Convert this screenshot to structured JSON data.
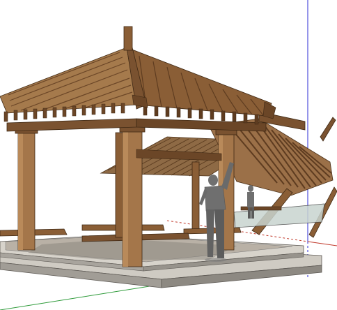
{
  "viewport": {
    "background": "#ffffff",
    "model": "3d-pavilion-model"
  },
  "axes": {
    "red_axis_color": "#c0392b",
    "green_axis_color": "#2e9b3a",
    "blue_axis_color": "#2b2bd6"
  },
  "materials": {
    "wood_light": "#a4764a",
    "wood_mid": "#8a5e36",
    "wood_dark": "#5e3c20",
    "wood_shadow": "#3e2814",
    "stone_top": "#c9c5bd",
    "stone_side": "#9a968f",
    "paving": "#b4aca2",
    "figure": "#6f6f6f",
    "glass": "#c8d4cf"
  }
}
